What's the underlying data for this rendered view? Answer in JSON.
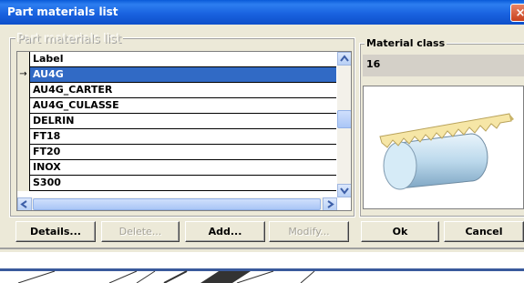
{
  "window": {
    "title": "Part materials list",
    "close_glyph": "×"
  },
  "list_panel": {
    "group_label": "Part materials list",
    "column_header": "Label",
    "row_indicator": "→",
    "rows": [
      "AU4G",
      "AU4G_CARTER",
      "AU4G_CULASSE",
      "DELRIN",
      "FT18",
      "FT20",
      "INOX",
      "S300"
    ],
    "selected_index": 0
  },
  "material_class": {
    "label": "Material class",
    "value": "16"
  },
  "buttons": {
    "details": "Details...",
    "delete": "Delete...",
    "add": "Add...",
    "modify": "Modify...",
    "ok": "Ok",
    "cancel": "Cancel"
  },
  "icons": {
    "scroll_up": "up-arrow-icon",
    "scroll_down": "down-arrow-icon",
    "scroll_left": "left-arrow-icon",
    "scroll_right": "right-arrow-icon",
    "preview": "saw-cutting-bar-icon"
  },
  "colors": {
    "selection": "#316ac5",
    "titlebar": "#0a5bd8",
    "dialog": "#ece9d8"
  }
}
